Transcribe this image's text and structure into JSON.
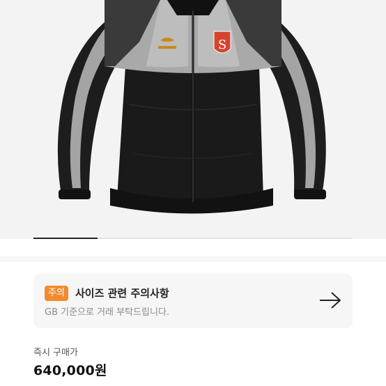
{
  "product": {
    "image_icon": "jacket-photo",
    "emblem_text": "S",
    "carousel_progress": 0.2
  },
  "notice": {
    "badge": "주의",
    "title": "사이즈 관련 주의사항",
    "description": "GB 기준으로 거래 부탁드립니다.",
    "arrow_icon": "arrow-right-icon"
  },
  "price": {
    "label": "즉시 구매가",
    "value": "640,000원"
  },
  "colors": {
    "badge": "#f28b2e",
    "jacket_black": "#161616",
    "jacket_gray": "#a9a9a9",
    "emblem_red": "#d6432e"
  }
}
